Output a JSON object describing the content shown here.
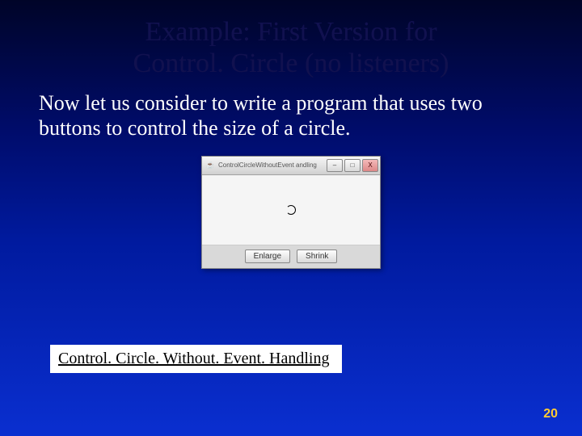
{
  "title_line1": "Example: First Version for",
  "title_line2": "Control. Circle (no listeners)",
  "body": "Now let us consider to write a program that uses two buttons to control the size of a circle.",
  "app_window": {
    "java_icon": "☕",
    "caption": "ControlCircleWithoutEvent andling",
    "min": "–",
    "max": "□",
    "close": "X",
    "button_enlarge": "Enlarge",
    "button_shrink": "Shrink"
  },
  "link_label": "Control. Circle. Without. Event. Handling",
  "page_number": "20"
}
